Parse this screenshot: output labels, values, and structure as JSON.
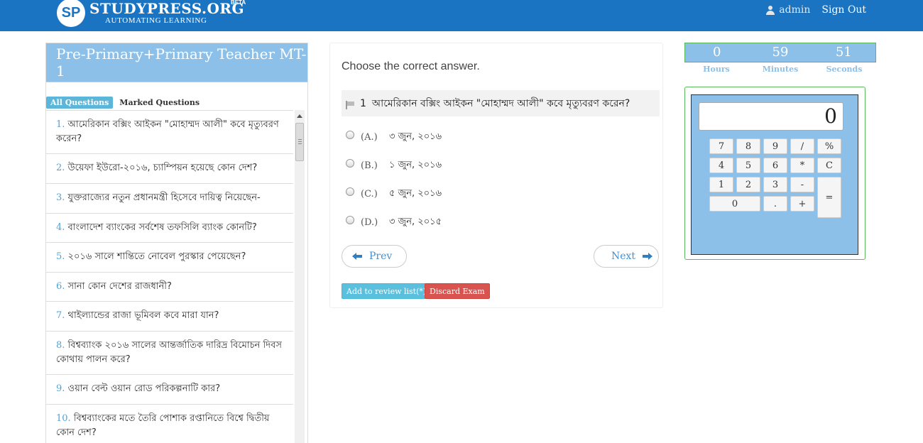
{
  "header": {
    "logo_mark": "SP",
    "brand": "STUDYPRESS.ORG",
    "beta": "BETA",
    "tagline": "AUTOMATING LEARNING",
    "username": "admin",
    "sign_out": "Sign Out",
    "bg_color": "#1a74c2"
  },
  "left_panel": {
    "title": "Pre-Primary+Primary Teacher MT- 1",
    "tab_all": "All Questions",
    "tab_marked": "Marked Questions",
    "questions": [
      {
        "num": "1.",
        "text": "আমেরিকান বক্সিং আইকন \"মোহাম্মদ আলী\" কবে মৃত্যুবরণ করেন?"
      },
      {
        "num": "2.",
        "text": "উয়েফা ইউরো-২০১৬, চ্যাম্পিয়ন হয়েছে কোন দেশ?"
      },
      {
        "num": "3.",
        "text": "যুক্তরাজ্যের নতুন প্রধানমন্ত্রী হিসেবে দায়িত্ব নিয়েছেন-"
      },
      {
        "num": "4.",
        "text": "বাংলাদেশ ব্যাংকের সর্বশেষ তফসিলি ব্যাংক কোনটি?"
      },
      {
        "num": "5.",
        "text": "২০১৬ সালে শান্তিতে নোবেল পুরস্কার পেয়েছেন?"
      },
      {
        "num": "6.",
        "text": "সানা কোন দেশের রাজধানী?"
      },
      {
        "num": "7.",
        "text": "থাইল্যান্ডের রাজা ভূমিবল কবে মারা যান?"
      },
      {
        "num": "8.",
        "text": " বিশ্বব্যাংক ২০১৬ সালের আন্তর্জাতিক দারিদ্র বিমোচন দিবস কোথায় পালন করে?"
      },
      {
        "num": "9.",
        "text": "ওয়ান বেল্ট ওয়ান রোড পরিকল্পনাটি কার?"
      },
      {
        "num": "10.",
        "text": "বিশ্বব্যাংকের মতে তৈরি পোশাক রপ্তানিতে বিশ্বে দ্বিতীয় কোন দেশ?"
      }
    ]
  },
  "question": {
    "instruction": "Choose the correct answer.",
    "number": "1",
    "text": "আমেরিকান বক্সিং আইকন \"মোহাম্মদ আলী\" কবে মৃত্যুবরণ করেন?",
    "options": [
      {
        "label": "(A.)",
        "text": "৩ জুন, ২০১৬"
      },
      {
        "label": "(B.)",
        "text": "১ জুন, ২০১৬"
      },
      {
        "label": "(C.)",
        "text": "৫ জুন, ২০১৬"
      },
      {
        "label": "(D.)",
        "text": "৩ জুন, ২০১৫"
      }
    ],
    "prev": "Prev",
    "next": "Next",
    "review": "Add to review list(*)",
    "discard": "Discard Exam"
  },
  "timer": {
    "hours": "0",
    "minutes": "59",
    "seconds": "51",
    "hours_label": "Hours",
    "minutes_label": "Minutes",
    "seconds_label": "Seconds"
  },
  "calculator": {
    "display": "0",
    "keys": [
      "7",
      "8",
      "9",
      "/",
      "%",
      "4",
      "5",
      "6",
      "*",
      "C",
      "1",
      "2",
      "3",
      "-",
      "=",
      "0",
      ".",
      "+"
    ]
  }
}
